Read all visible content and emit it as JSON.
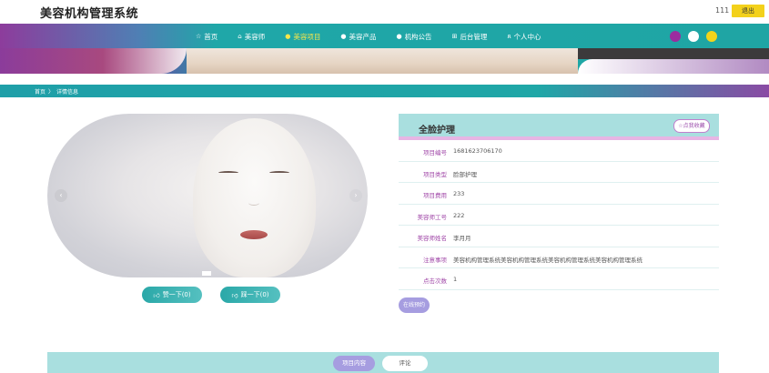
{
  "header": {
    "site_title": "美容机构管理系统",
    "username": "111",
    "logout_label": "退出"
  },
  "nav": {
    "items": [
      {
        "icon": "star-icon",
        "label": "首页"
      },
      {
        "icon": "home-icon",
        "label": "美容师"
      },
      {
        "icon": "dot-icon",
        "label": "美容项目",
        "active": true
      },
      {
        "icon": "dot-icon",
        "label": "美容产品"
      },
      {
        "icon": "dot-icon",
        "label": "机构公告"
      },
      {
        "icon": "grid-icon",
        "label": "后台管理"
      },
      {
        "icon": "user-icon",
        "label": "个人中心"
      }
    ],
    "theme_dots": [
      "#9b2c9f",
      "#ffffff",
      "#f3d41b"
    ]
  },
  "breadcrumb": {
    "home": "首页",
    "separator": "〉",
    "current": "详情信息"
  },
  "gallery": {
    "like_label": "赞一下(0)",
    "dislike_label": "踩一下(0)"
  },
  "detail": {
    "title": "全脸护理",
    "collect_label": "☆点我收藏",
    "fields": [
      {
        "label": "项目编号",
        "value": "1681623706170"
      },
      {
        "label": "项目类型",
        "value": "脸部护理"
      },
      {
        "label": "项目费用",
        "value": "233"
      },
      {
        "label": "美容师工号",
        "value": "222"
      },
      {
        "label": "美容师姓名",
        "value": "李月月"
      },
      {
        "label": "注意事项",
        "value": "美容机构管理系统美容机构管理系统美容机构管理系统美容机构管理系统"
      },
      {
        "label": "点击次数",
        "value": "1"
      }
    ],
    "book_label": "在线预约"
  },
  "tabs": {
    "content_label": "项目内容",
    "comment_label": "评论"
  },
  "colors": {
    "teal": "#1fa7a7",
    "purple": "#8a3d99",
    "accent_yellow": "#f3d11b",
    "label_purple": "#a148a8"
  }
}
